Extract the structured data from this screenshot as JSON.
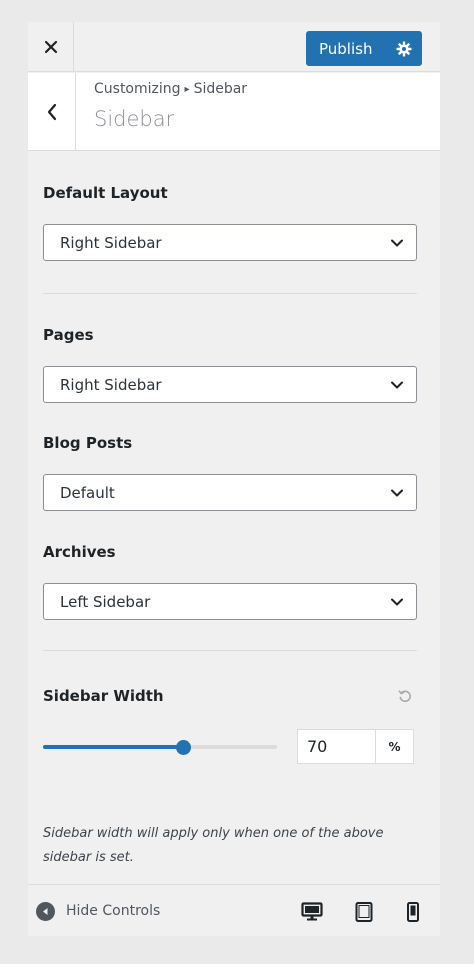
{
  "header": {
    "close_icon": "close-icon",
    "publish_label": "Publish",
    "gear_icon": "gear-icon"
  },
  "section": {
    "breadcrumb_root": "Customizing",
    "breadcrumb_current": "Sidebar",
    "title": "Sidebar"
  },
  "fields": {
    "default_layout": {
      "label": "Default Layout",
      "value": "Right Sidebar"
    },
    "pages": {
      "label": "Pages",
      "value": "Right Sidebar"
    },
    "blog_posts": {
      "label": "Blog Posts",
      "value": "Default"
    },
    "archives": {
      "label": "Archives",
      "value": "Left Sidebar"
    }
  },
  "sidebar_width": {
    "label": "Sidebar Width",
    "value": "70",
    "fraction": 0.6,
    "unit": "%",
    "description": "Sidebar width will apply only when one of the above sidebar is set."
  },
  "footer": {
    "hide_controls_label": "Hide Controls",
    "devices": [
      "desktop-icon",
      "tablet-icon",
      "mobile-icon"
    ]
  },
  "colors": {
    "accent": "#2271b1",
    "panel_bg": "#f0f0f1",
    "border": "#dcdcde"
  }
}
